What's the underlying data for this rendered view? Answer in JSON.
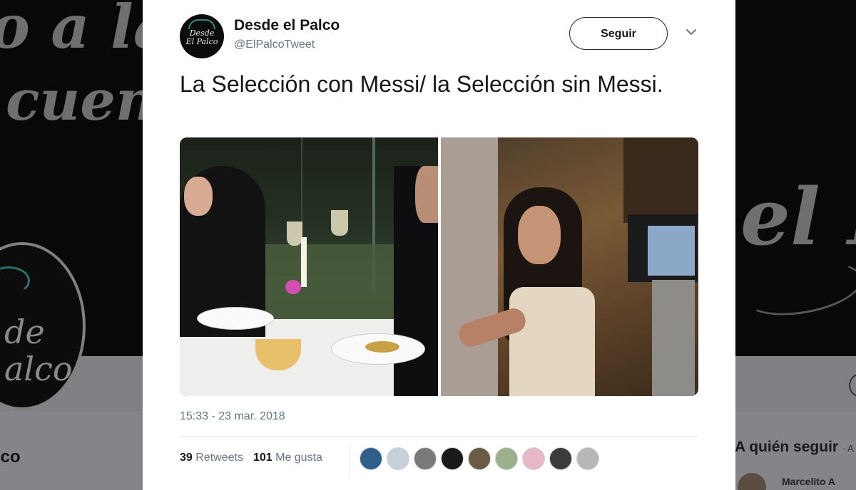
{
  "background": {
    "banner_line1": "o a las",
    "banner_line2": "cuent",
    "banner_right": "el P",
    "avatar_text_1": "de",
    "avatar_text_2": "alco",
    "profile_name": "lco",
    "who_to_follow": "A quién seguir",
    "who_to_follow_extra": "· A",
    "suggested_user": "Marcelito A"
  },
  "tweet": {
    "avatar_text_1": "Desde",
    "avatar_text_2": "El Palco",
    "name": "Desde el Palco",
    "handle": "@ElPalcoTweet",
    "follow_label": "Seguir",
    "text": "La Selección con Messi/ la Selección sin Messi.",
    "timestamp": "15:33 - 23 mar. 2018",
    "retweets_count": "39",
    "retweets_label": "Retweets",
    "likes_count": "101",
    "likes_label": "Me gusta"
  },
  "liker_avatar_colors": [
    "#2d5f8a",
    "#c7d1da",
    "#7a7a7a",
    "#1a1a1a",
    "#6b5a46",
    "#9db08c",
    "#e9b8c7",
    "#3b3b3b",
    "#b7b7b7"
  ],
  "colors": {
    "text_primary": "#14171a",
    "text_secondary": "#657786",
    "divider": "#e6ecf0"
  }
}
